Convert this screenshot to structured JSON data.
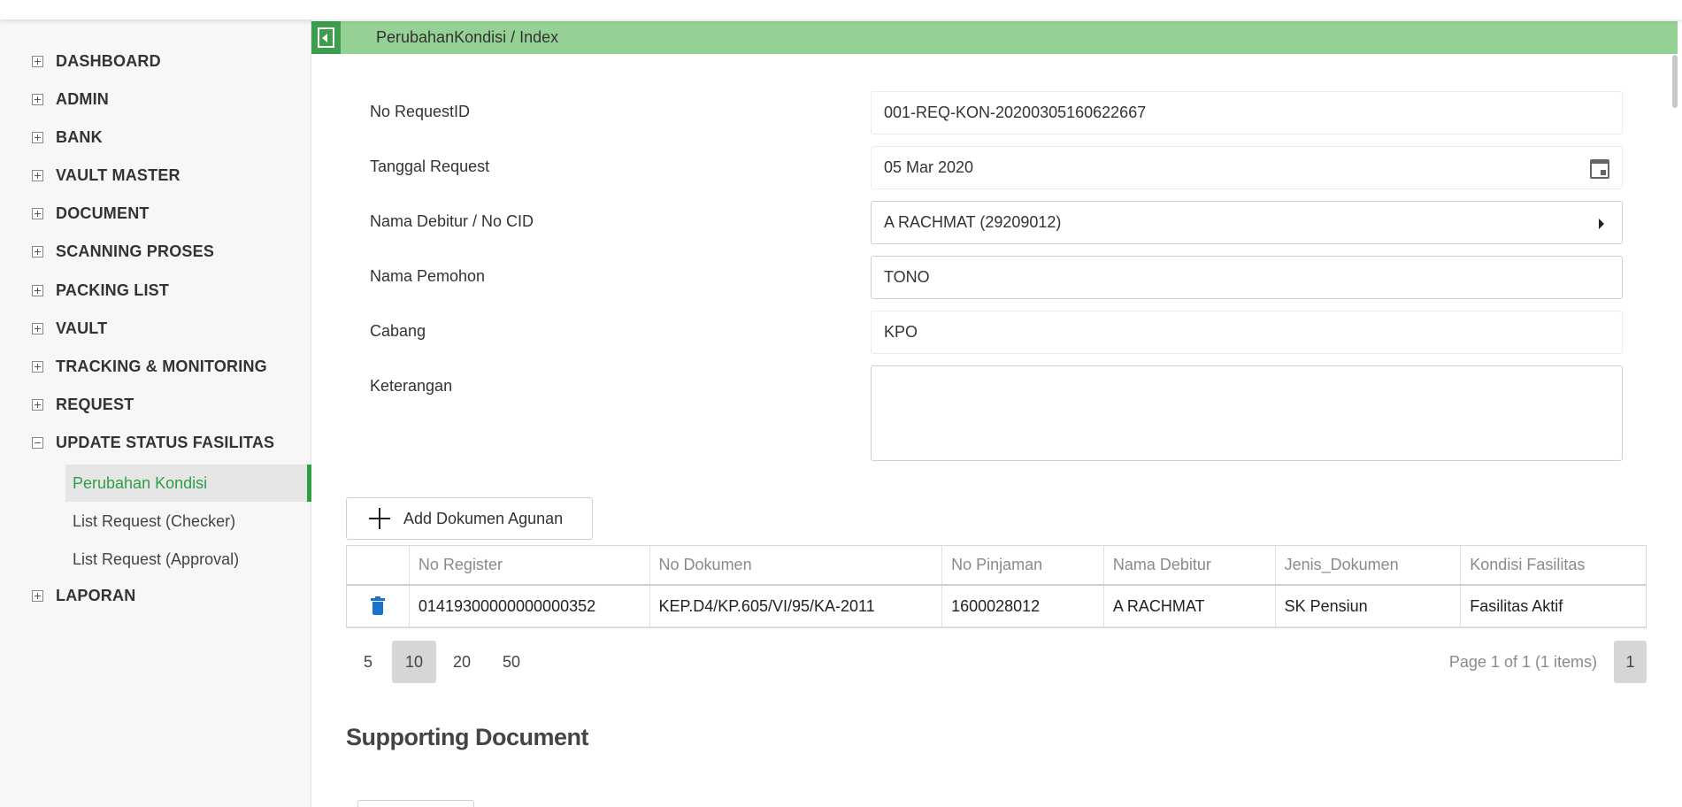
{
  "sidebar": {
    "menu": [
      {
        "label": "DASHBOARD",
        "expanded": false
      },
      {
        "label": "ADMIN",
        "expanded": false
      },
      {
        "label": "BANK",
        "expanded": false
      },
      {
        "label": "VAULT MASTER",
        "expanded": false
      },
      {
        "label": "DOCUMENT",
        "expanded": false
      },
      {
        "label": "SCANNING PROSES",
        "expanded": false
      },
      {
        "label": "PACKING LIST",
        "expanded": false
      },
      {
        "label": "VAULT",
        "expanded": false
      },
      {
        "label": "TRACKING & MONITORING",
        "expanded": false
      },
      {
        "label": "REQUEST",
        "expanded": false
      },
      {
        "label": "UPDATE STATUS FASILITAS",
        "expanded": true
      },
      {
        "label": "LAPORAN",
        "expanded": false
      }
    ],
    "submenu": [
      {
        "label": "Perubahan Kondisi",
        "active": true
      },
      {
        "label": "List Request (Checker)",
        "active": false
      },
      {
        "label": "List Request (Approval)",
        "active": false
      }
    ]
  },
  "header": {
    "breadcrumb": "PerubahanKondisi / Index"
  },
  "form": {
    "no_request_label": "No RequestID",
    "no_request_value": "001-REQ-KON-20200305160622667",
    "tanggal_label": "Tanggal Request",
    "tanggal_value": "05 Mar 2020",
    "debitur_label": "Nama Debitur / No CID",
    "debitur_value": "A RACHMAT (29209012)",
    "pemohon_label": "Nama Pemohon",
    "pemohon_value": "TONO",
    "cabang_label": "Cabang",
    "cabang_value": "KPO",
    "keterangan_label": "Keterangan",
    "keterangan_value": ""
  },
  "grid": {
    "add_button_label": "Add Dokumen Agunan",
    "columns": [
      "",
      "No Register",
      "No Dokumen",
      "No Pinjaman",
      "Nama Debitur",
      "Jenis_Dokumen",
      "Kondisi Fasilitas"
    ],
    "rows": [
      [
        "",
        "01419300000000000352",
        "KEP.D4/KP.605/VI/95/KA-2011",
        "1600028012",
        "A RACHMAT",
        "SK Pensiun",
        "Fasilitas Aktif"
      ]
    ]
  },
  "pager": {
    "sizes": [
      "5",
      "10",
      "20",
      "50"
    ],
    "active_size": "10",
    "info": "Page 1 of 1 (1 items)",
    "current_page": "1"
  },
  "supporting": {
    "title": "Supporting Document"
  },
  "colors": {
    "accent": "#2e9e44",
    "header_bg": "#95d095",
    "trash": "#1a73c8"
  }
}
